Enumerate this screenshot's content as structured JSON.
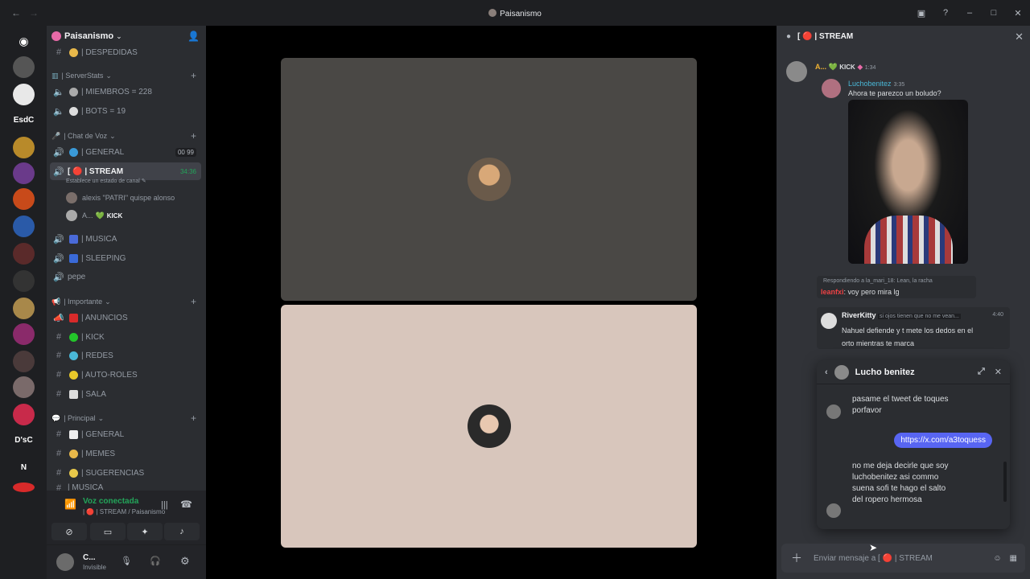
{
  "titlebar": {
    "title": "Paisanismo"
  },
  "rail": {
    "labels": [
      "EsdC",
      "D'sC",
      "N"
    ]
  },
  "sidebar": {
    "server_name": "Paisanismo",
    "top_item": "| DESPEDIDAS",
    "categories": [
      "| ServerStats",
      "| Chat de Voz",
      "| Importante",
      "| Principal"
    ],
    "serverstats": [
      "| MIEMBROS = 228",
      "| BOTS = 19"
    ],
    "voice": {
      "general": "| GENERAL",
      "general_badges": [
        "00",
        "99"
      ],
      "stream": "[ 🔴 | STREAM",
      "stream_time": "34:36",
      "stream_status": "Establece un estado de canal",
      "users": [
        "alexis \"PATRI\" quispe alonso",
        "A..."
      ],
      "kick_tag": "KICK",
      "others": [
        "| MUSICA",
        "| SLEEPING",
        "pepe"
      ]
    },
    "importante": [
      "| ANUNCIOS",
      "| KICK",
      "| REDES",
      "| AUTO-ROLES",
      "| SALA"
    ],
    "principal": [
      "| GENERAL",
      "| MEMES",
      "| SUGERENCIAS",
      "| MUSICA"
    ]
  },
  "voice_panel": {
    "status": "Voz conectada",
    "sub": "| 🔴 | STREAM / Paisanismo"
  },
  "user_panel": {
    "name": "C...",
    "status": "Invisible"
  },
  "chat": {
    "header": "[ 🔴 | STREAM",
    "msg1": {
      "author": "A...",
      "tag": "KICK",
      "time": "1:34"
    },
    "msg2": {
      "author": "Luchobenitez",
      "time": "3:35",
      "text": "Ahora te parezco un boludo?"
    },
    "reply": {
      "ref": "Respondiendo a la_mari_18: Lean, la racha",
      "author": "leanfxi",
      "text": ": voy pero mira lg"
    },
    "msg3": {
      "author": "RiverKitty",
      "sub": "si ojos tienen que no me vean...",
      "time": "4:40",
      "text": "Nahuel defiende y t mete los dedos en el orto mientras te marca"
    },
    "composer_placeholder": "Enviar mensaje a [ 🔴 | STREAM"
  },
  "dm": {
    "name": "Lucho benitez",
    "messages": [
      "pasame el tweet de toques porfavor",
      "no me deja decirle que soy luchobenitez asi commo suena sofi te hago el salto del ropero hermosa"
    ],
    "link": "https://x.com/a3toquess"
  },
  "colors": {
    "accent": "#5865f2",
    "online": "#23a55a",
    "stream_red": "#ed4245",
    "tile1": "#4a4845",
    "tile2": "#d8c6bc"
  }
}
